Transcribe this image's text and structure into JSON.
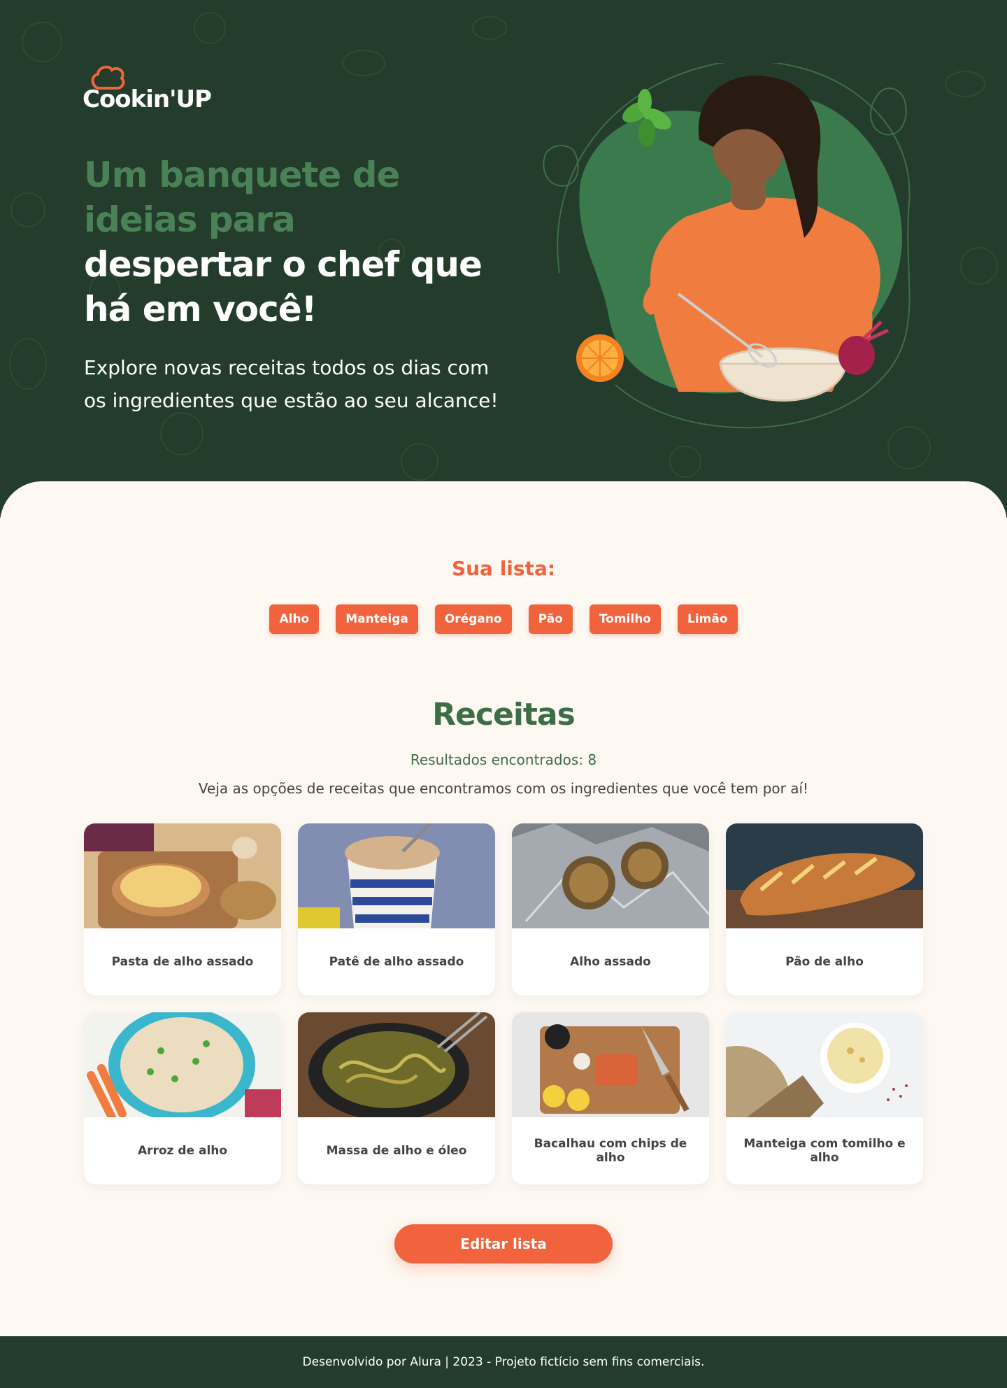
{
  "brand": {
    "name": "Cookin'UP"
  },
  "hero": {
    "headline_green_1": "Um banquete de",
    "headline_green_2": "ideias para",
    "headline_white_1": "despertar o chef que",
    "headline_white_2": "há em você!",
    "subtitle_1": "Explore novas receitas todos os dias com",
    "subtitle_2": "os ingredientes que estão ao seu alcance!"
  },
  "list": {
    "title": "Sua lista:",
    "items": [
      "Alho",
      "Manteiga",
      "Orégano",
      "Pão",
      "Tomilho",
      "Limão"
    ]
  },
  "recipes": {
    "title": "Receitas",
    "results": "Resultados encontrados: 8",
    "description": "Veja as opções de receitas que encontramos com os ingredientes que você tem por aí!",
    "items": [
      {
        "name": "Pasta de alho assado"
      },
      {
        "name": "Patê de alho assado"
      },
      {
        "name": "Alho assado"
      },
      {
        "name": "Pão de alho"
      },
      {
        "name": "Arroz de alho"
      },
      {
        "name": "Massa de alho e óleo"
      },
      {
        "name": "Bacalhau com chips de alho"
      },
      {
        "name": "Manteiga com tomilho e alho"
      }
    ],
    "edit_button": "Editar lista"
  },
  "footer": {
    "text": "Desenvolvido por Alura | 2023 - Projeto fictício sem fins comerciais."
  },
  "colors": {
    "dark_green": "#233c2b",
    "medium_green": "#3d6e47",
    "light_green": "#4b8157",
    "orange": "#f0633c",
    "cream": "#fdf8f2"
  }
}
